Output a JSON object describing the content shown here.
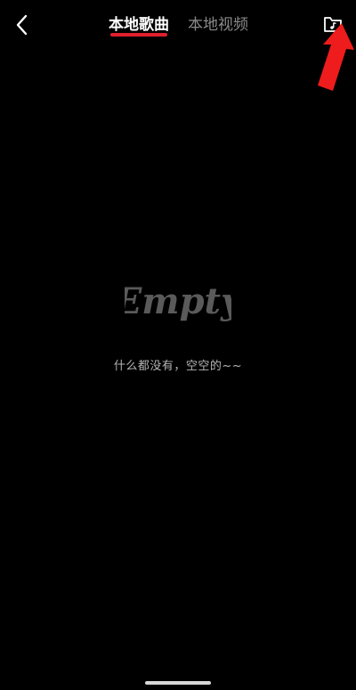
{
  "header": {
    "back_icon": "chevron-left-icon",
    "tabs": [
      {
        "label": "本地歌曲",
        "active": true
      },
      {
        "label": "本地视频",
        "active": false
      }
    ],
    "folder_icon": "folder-music-icon",
    "annotation_icon": "red-arrow-icon"
  },
  "empty_state": {
    "logo_text": "Empty",
    "message": "什么都没有，空空的~~"
  },
  "colors": {
    "background": "#000000",
    "active_tab": "#ffffff",
    "inactive_tab": "#8a8a8a",
    "tab_underline": "#e0202c",
    "empty_logo": "#5a5a5a",
    "annotation_arrow": "#ee1c1c"
  }
}
